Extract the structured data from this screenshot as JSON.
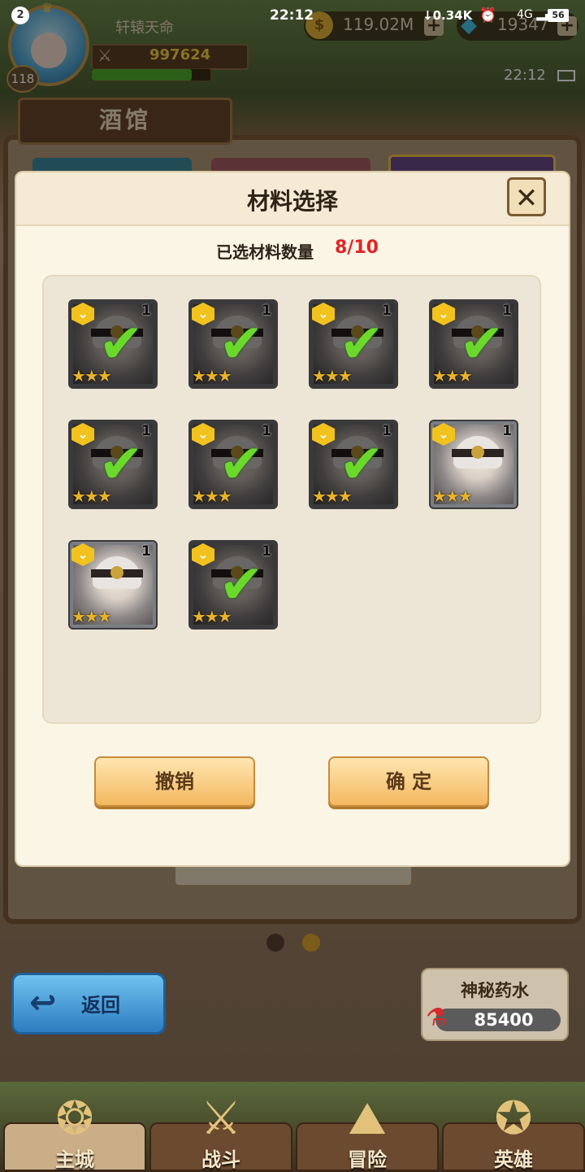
{
  "status_bar": {
    "notification_count": "2",
    "time": "22:12",
    "net_speed": "0.34K",
    "signal": "4G",
    "battery": "56"
  },
  "hud": {
    "player_name": "轩辕天命",
    "level": "118",
    "power": "997624",
    "gold": "119.02M",
    "gems": "19347",
    "game_clock": "22:12",
    "exp_progress": 0.84
  },
  "page": {
    "title": "酒馆"
  },
  "modal": {
    "title": "材料选择",
    "close_label": "✕",
    "count_label": "已选材料数量",
    "count_value": "8/10",
    "cancel_label": "撤销",
    "confirm_label": "确 定",
    "cards": [
      {
        "level": "1",
        "stars": 3,
        "selected": true
      },
      {
        "level": "1",
        "stars": 3,
        "selected": true
      },
      {
        "level": "1",
        "stars": 3,
        "selected": true
      },
      {
        "level": "1",
        "stars": 3,
        "selected": true
      },
      {
        "level": "1",
        "stars": 3,
        "selected": true
      },
      {
        "level": "1",
        "stars": 3,
        "selected": true
      },
      {
        "level": "1",
        "stars": 3,
        "selected": true
      },
      {
        "level": "1",
        "stars": 3,
        "selected": false
      },
      {
        "level": "1",
        "stars": 3,
        "selected": false
      },
      {
        "level": "1",
        "stars": 3,
        "selected": true
      }
    ]
  },
  "return_button": {
    "label": "返回"
  },
  "potion": {
    "title": "神秘药水",
    "value": "85400"
  },
  "bottom_nav": [
    {
      "label": "主城",
      "active": true
    },
    {
      "label": "战斗",
      "active": false
    },
    {
      "label": "冒险",
      "active": false
    },
    {
      "label": "英雄",
      "active": false
    }
  ],
  "colors": {
    "count_highlight": "#e0252a",
    "check": "#6bd92c",
    "star": "#e8b32a",
    "accent_button": "#f3b860"
  }
}
